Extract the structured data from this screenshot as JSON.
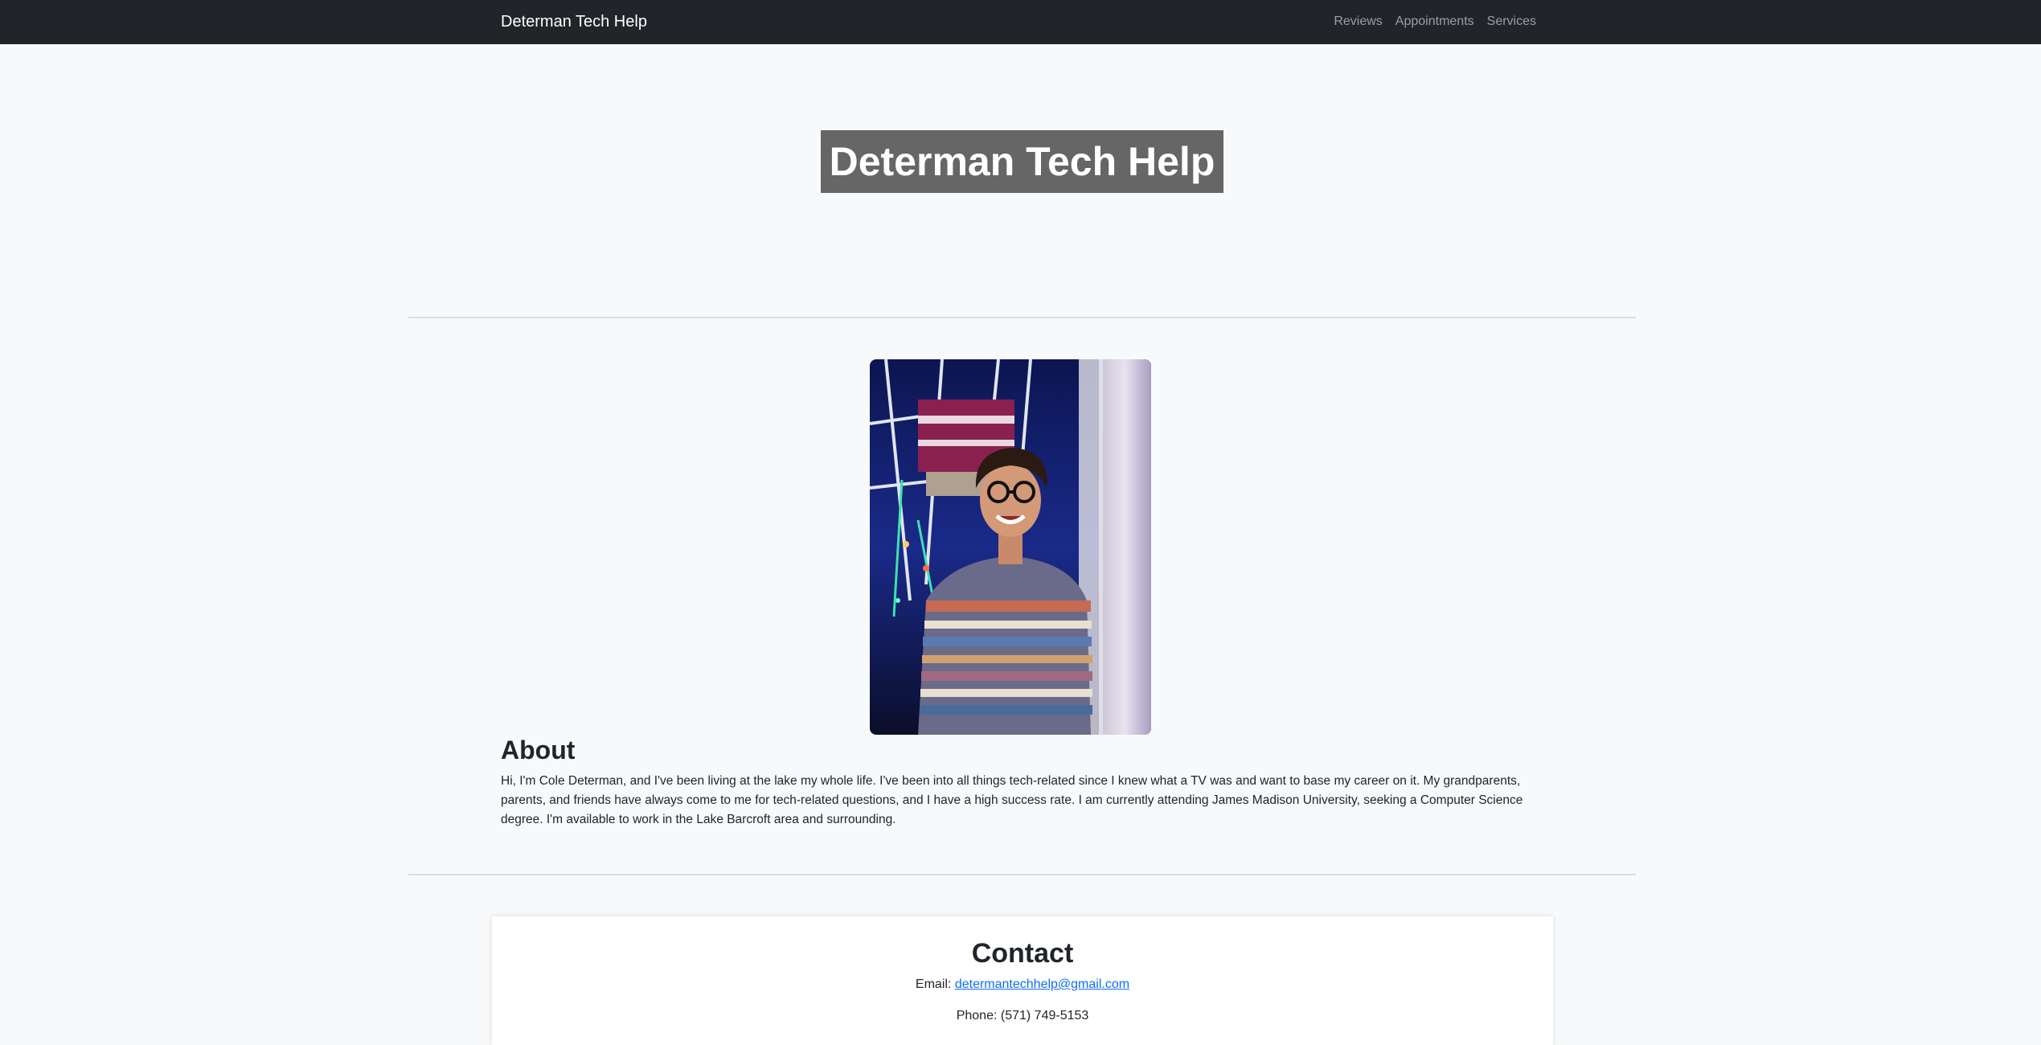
{
  "navbar": {
    "brand": "Determan Tech Help",
    "links": [
      "Reviews",
      "Appointments",
      "Services"
    ]
  },
  "hero": {
    "title": "Determan Tech Help"
  },
  "about": {
    "heading": "About",
    "text": "Hi, I'm Cole Determan, and I've been living at the lake my whole life. I've been into all things tech-related since I knew what a TV was and want to base my career on it. My grandparents, parents, and friends have always come to me for tech-related questions, and I have a high success rate. I am currently attending James Madison University, seeking a Computer Science degree. I'm available to work in the Lake Barcroft area and surrounding."
  },
  "contact": {
    "heading": "Contact",
    "email_label": "Email:",
    "email": "determantechhelp@gmail.com",
    "phone_label": "Phone:",
    "phone": "(571) 749-5153"
  },
  "colors": {
    "navbar_bg": "#212529",
    "page_bg": "#f8f9fa",
    "hero_title_bg": "#666666",
    "link": "#0d6efd"
  }
}
